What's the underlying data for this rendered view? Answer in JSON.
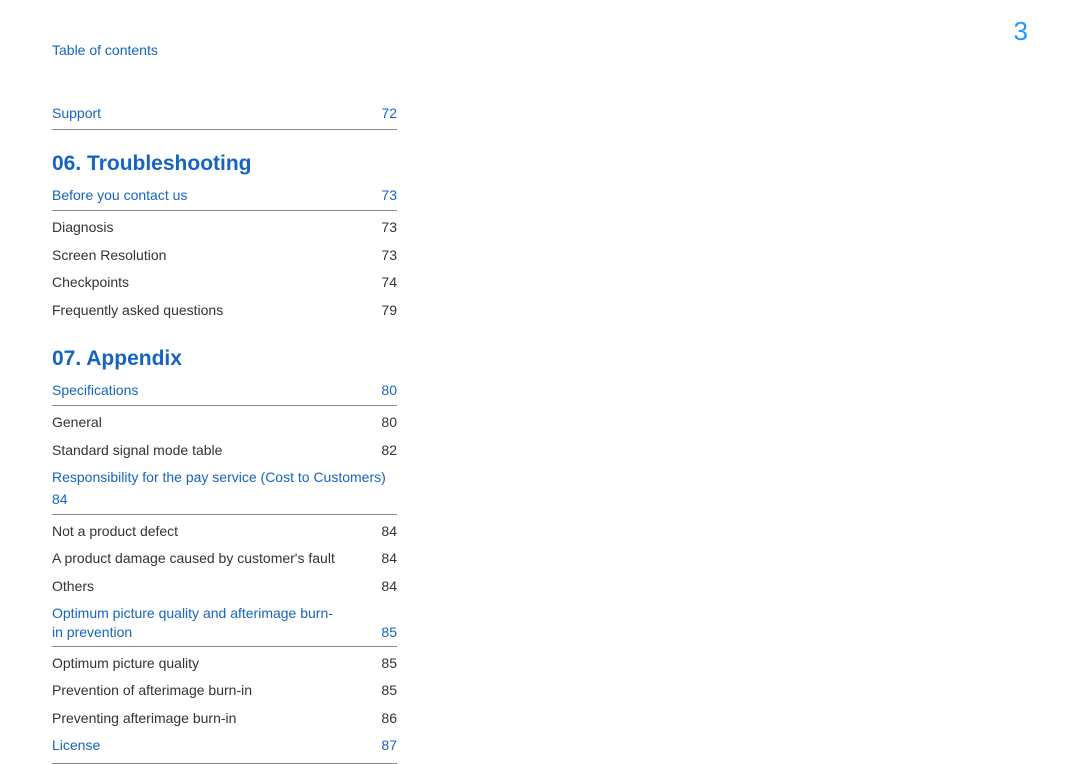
{
  "header": {
    "toc_label": "Table of contents",
    "page_number": "3"
  },
  "top_row": {
    "label": "Support",
    "page": "72"
  },
  "chapters": [
    {
      "title": "06. Troubleshooting",
      "sections": [
        {
          "heading": {
            "label": "Before you contact us",
            "page": "73"
          },
          "items": [
            {
              "label": "Diagnosis",
              "page": "73"
            },
            {
              "label": "Screen Resolution",
              "page": "73"
            },
            {
              "label": "Checkpoints",
              "page": "74"
            },
            {
              "label": "Frequently asked questions",
              "page": "79"
            }
          ]
        }
      ]
    },
    {
      "title": "07.  Appendix",
      "sections": [
        {
          "heading": {
            "label": "Specifications",
            "page": "80"
          },
          "items": [
            {
              "label": "General",
              "page": "80"
            },
            {
              "label": "Standard signal mode table",
              "page": "82"
            }
          ]
        },
        {
          "heading_wrap": {
            "label": "Responsibility for the pay service (Cost to Customers)",
            "page": "84"
          },
          "items": [
            {
              "label": "Not a product defect",
              "page": "84"
            },
            {
              "label": "A product damage caused by customer's fault",
              "page": "84"
            },
            {
              "label": "Others",
              "page": "84"
            }
          ]
        },
        {
          "heading_wrap_inline": {
            "label": "Optimum picture quality and afterimage burn-in prevention",
            "page": "85"
          },
          "items": [
            {
              "label": "Optimum picture quality",
              "page": "85"
            },
            {
              "label": "Prevention of afterimage burn-in",
              "page": "85"
            },
            {
              "label": "Preventing afterimage burn-in",
              "page": "86"
            }
          ]
        },
        {
          "heading": {
            "label": "License",
            "page": "87"
          },
          "items": []
        }
      ]
    }
  ]
}
